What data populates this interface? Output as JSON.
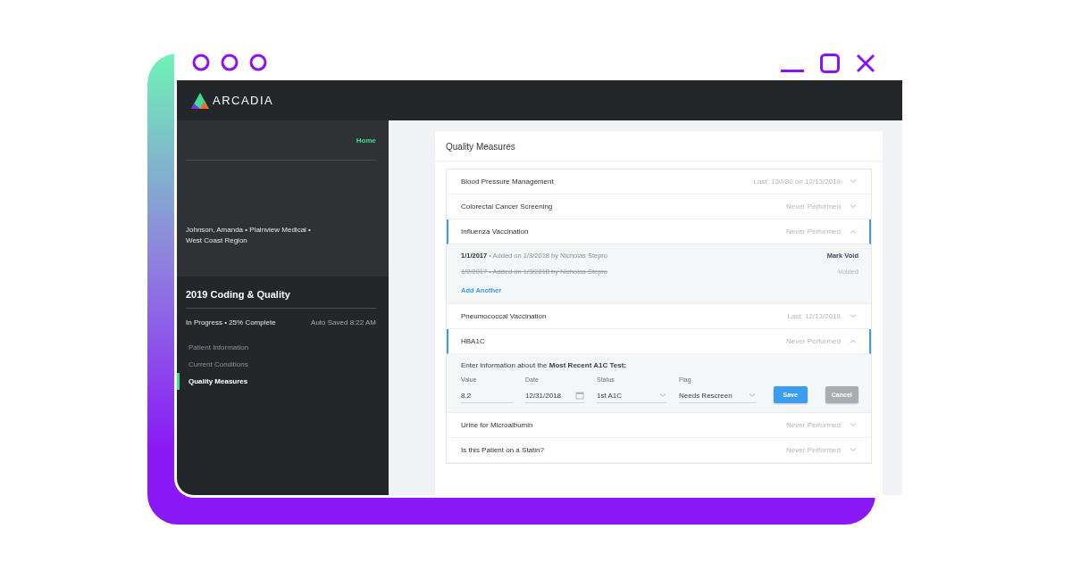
{
  "app": {
    "logo_text": "ARCADIA"
  },
  "sidebar": {
    "home_link": "Home",
    "patient": "Johnson, Amanda • Plainview Medical • West Coast Region",
    "section_title": "2019 Coding & Quality",
    "progress": "In Progress • 25% Complete",
    "autosave": "Auto Saved 8:22 AM",
    "nav": [
      {
        "label": "Patient Information",
        "selected": false
      },
      {
        "label": "Current Conditions",
        "selected": false
      },
      {
        "label": "Quality Measures",
        "selected": true
      }
    ]
  },
  "main": {
    "title": "Quality Measures",
    "measures": [
      {
        "name": "Blood Pressure Management",
        "status": "Last: 130/80 on 12/13/2018",
        "expanded": false
      },
      {
        "name": "Colorectal Cancer Screening",
        "status": "Never Performed",
        "expanded": false
      },
      {
        "name": "Influenza Vaccination",
        "status": "Never Performed",
        "expanded": true,
        "kind": "history",
        "entries": [
          {
            "date": "1/1/2017",
            "text": "• Added on 1/3/2018 by Nicholas Stepro",
            "action": "Mark Void",
            "voided": false
          },
          {
            "date": "1/2/2017",
            "text": "• Added on 1/3/2018 by Nicholas Stepro",
            "action": "Voided",
            "voided": true
          }
        ],
        "add_link": "Add Another"
      },
      {
        "name": "Pneumococcal Vaccination",
        "status": "Last: 12/13/2018",
        "expanded": false
      },
      {
        "name": "HBA1C",
        "status": "Never Performed",
        "expanded": true,
        "kind": "form",
        "prompt": "Enter information about the **Most Recent A1C Test:**",
        "fields": [
          {
            "label": "Value",
            "value": "8.2",
            "kind": "text"
          },
          {
            "label": "Date",
            "value": "12/31/2018",
            "kind": "date"
          },
          {
            "label": "Status",
            "value": "1st A1C",
            "kind": "select"
          },
          {
            "label": "Flag",
            "value": "Needs Rescreen",
            "kind": "select"
          }
        ],
        "buttons": [
          {
            "label": "Save",
            "disabled": false
          },
          {
            "label": "Cancel",
            "disabled": true
          }
        ]
      },
      {
        "name": "Urine for Microalbumin",
        "status": "Never Performed",
        "expanded": false
      },
      {
        "name": "Is this Patient on a Statin?",
        "status": "Never Performed",
        "expanded": false
      }
    ]
  }
}
